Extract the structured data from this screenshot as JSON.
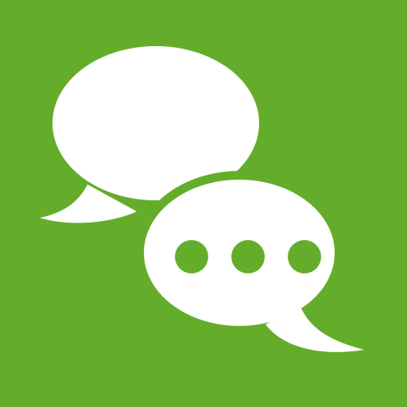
{
  "icon": {
    "name": "messages-app-icon",
    "glyph": "two-speech-bubbles-with-typing-dots",
    "colors": {
      "background": "#64ad2b",
      "bubble": "#ffffff",
      "dots": "#64ad2b"
    },
    "typing_dots_count": 3
  }
}
